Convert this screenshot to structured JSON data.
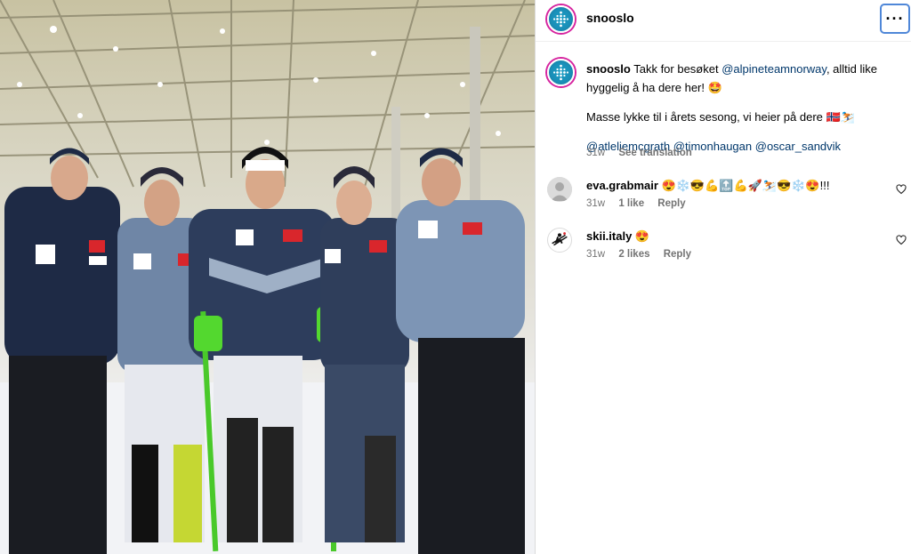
{
  "post": {
    "username": "snooslo",
    "more_icon": "more-horizontal-icon"
  },
  "caption": {
    "username": "snooslo",
    "text_1": " Takk for besøket ",
    "mention_1": "@alpineteamnorway",
    "text_2": ", alltid like hyggelig å ha dere her! 🤩",
    "line_2": "Masse lykke til i årets sesong, vi heier på dere 🇳🇴⛷️",
    "mention_2": "@atleliemcgrath",
    "mention_3": "@timonhaugan",
    "mention_4": "@oscar_sandvik",
    "time": "31w",
    "see_translation": "See translation"
  },
  "comments": [
    {
      "username": "eva.grabmair",
      "text": " 😍❄️😎💪🔝💪🚀⛷️😎❄️😍!!!",
      "time": "31w",
      "likes": "1 like",
      "reply": "Reply"
    },
    {
      "username": "skii.italy",
      "text": " 😍",
      "time": "31w",
      "likes": "2 likes",
      "reply": "Reply"
    }
  ],
  "colors": {
    "accent": "#0095f6",
    "mention": "#00376b",
    "meta": "#737373",
    "avatar": "#1a8fb8",
    "more_button_border": "#4f87d8"
  }
}
